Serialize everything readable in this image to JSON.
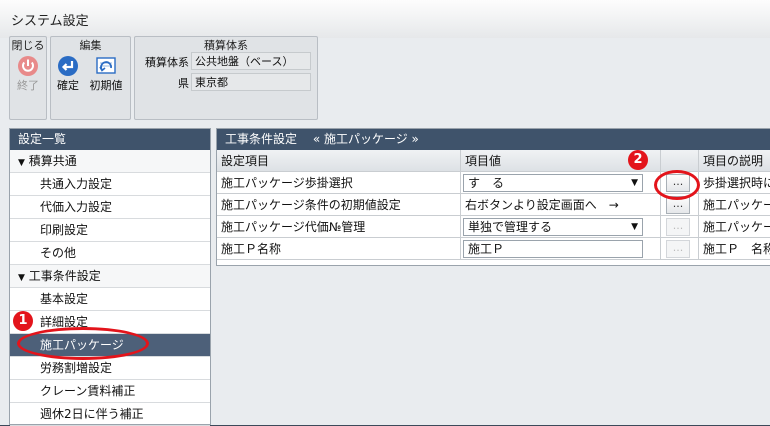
{
  "window": {
    "title": "システム設定"
  },
  "ribbon": {
    "close_group": {
      "title": "閉じる",
      "exit_label": "終了"
    },
    "edit_group": {
      "title": "編集",
      "confirm_label": "確定",
      "reset_label": "初期値"
    },
    "estimate_group": {
      "title": "積算体系",
      "system_key": "積算体系",
      "system_value": "公共地盤（ベース）",
      "pref_key": "県",
      "pref_value": "東京都"
    }
  },
  "sidebar": {
    "header": "設定一覧",
    "categories": [
      {
        "label": "積算共通",
        "items": [
          "共通入力設定",
          "代価入力設定",
          "印刷設定",
          "その他"
        ]
      },
      {
        "label": "工事条件設定",
        "items": [
          "基本設定",
          "詳細設定",
          "施工パッケージ",
          "労務割増設定",
          "クレーン賃料補正",
          "週休2日に伴う補正"
        ]
      }
    ],
    "selected": "施工パッケージ"
  },
  "main": {
    "header": "工事条件設定　 « 施工パッケージ »",
    "columns": [
      "設定項目",
      "項目値",
      "",
      "項目の説明"
    ],
    "rows": [
      {
        "item": "施工パッケージ歩掛選択",
        "value": "す　る",
        "control": "select",
        "button": "...",
        "button_enabled": true,
        "desc": "歩掛選択時に"
      },
      {
        "item": "施工パッケージ条件の初期値設定",
        "value": "右ボタンより設定画面へ　→",
        "control": "text",
        "button": "...",
        "button_enabled": true,
        "desc": "施工パッケー"
      },
      {
        "item": "施工パッケージ代価№管理",
        "value": "単独で管理する",
        "control": "select",
        "button": "...",
        "button_enabled": false,
        "desc": "施工パッケー"
      },
      {
        "item": "施工Ｐ名称",
        "value": "施工Ｐ",
        "control": "input",
        "button": "...",
        "button_enabled": false,
        "desc": "施工Ｐ　名称"
      }
    ]
  },
  "annotations": {
    "badge1": "1",
    "badge2": "2"
  },
  "colors": {
    "header_bg": "#3f536b",
    "selected_bg": "#4d6079",
    "annotation_red": "#e3141b"
  },
  "icons": [
    "power-icon",
    "confirm-icon",
    "reset-icon",
    "tree-collapse-icon",
    "dropdown-arrow-icon"
  ]
}
